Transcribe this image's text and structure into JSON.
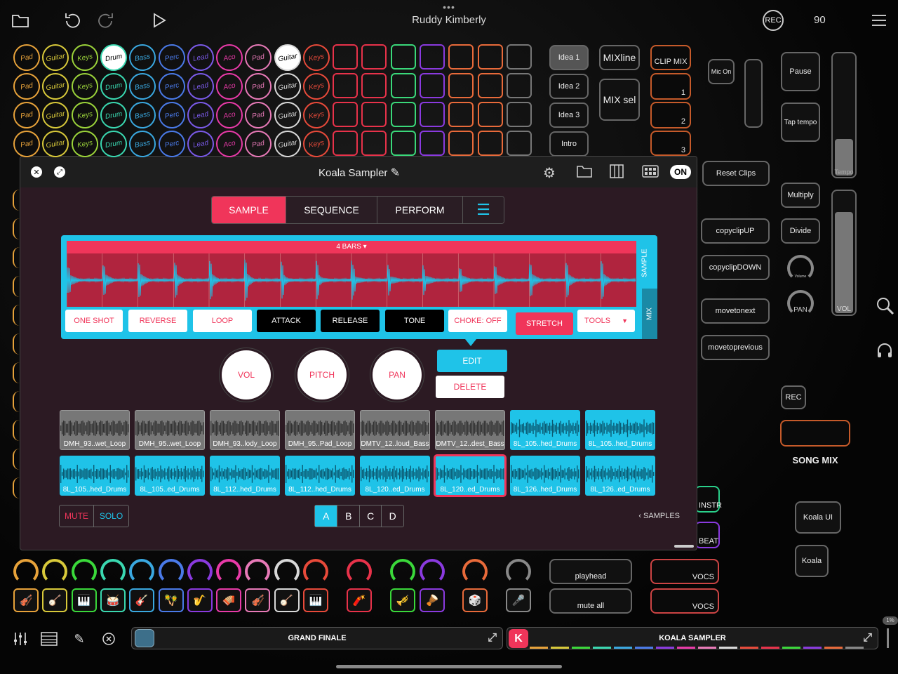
{
  "app": {
    "title": "Ruddy Kimberly",
    "tempo": "90",
    "rec_label": "REC"
  },
  "top_icons": [
    "folder-icon",
    "undo-icon",
    "redo-icon",
    "play-icon",
    "menu-icon"
  ],
  "pad_row_labels": [
    "Pad",
    "Guitar",
    "Keys",
    "Drum",
    "Bass",
    "Perc",
    "Lead",
    "Aco",
    "Pad",
    "Guitar",
    "Keys"
  ],
  "right_buttons": {
    "idea1": "Idea 1",
    "idea2": "Idea 2",
    "idea3": "Idea 3",
    "intro": "Intro",
    "mixline": "MIXline",
    "mixsel": "MIX sel",
    "clipmix": "CLIP MIX",
    "clip1": "1",
    "clip2": "2",
    "clip3": "3",
    "micon": "Mic On",
    "pause": "Pause",
    "taptempo": "Tap tempo",
    "tempo_label": "Tempo",
    "resetclips": "Reset Clips",
    "multiply": "Multiply",
    "copyclipup": "copyclipUP",
    "divide": "Divide",
    "copyclipdown": "copyclipDOWN",
    "volume": "Volume",
    "pan": "PAN",
    "vol": "VOL",
    "movetonext": "movetonext",
    "movetoprevious": "movetoprevious",
    "rec": "REC",
    "songmix": "SONG MIX",
    "koalaui": "Koala UI",
    "koala": "Koala",
    "instr": "INSTR",
    "beat": "BEAT",
    "playhead": "playhead",
    "muteall": "mute all",
    "vocs1": "VOCS",
    "vocs2": "VOCS"
  },
  "sampler": {
    "title": "Koala Sampler",
    "on_label": "ON",
    "tabs": [
      "SAMPLE",
      "SEQUENCE",
      "PERFORM"
    ],
    "bars_label": "4 BARS ▾",
    "side_sample": "SAMPLE",
    "side_mix": "MIX",
    "wave_buttons": [
      "ONE SHOT",
      "REVERSE",
      "LOOP",
      "ATTACK",
      "RELEASE",
      "TONE",
      "CHOKE: OFF",
      "STRETCH",
      "TOOLS"
    ],
    "knobs": [
      "VOL",
      "PITCH",
      "PAN"
    ],
    "edit": "EDIT",
    "delete": "DELETE",
    "samples_row1": [
      "DMH_93..wet_Loop",
      "DMH_95..wet_Loop",
      "DMH_93..lody_Loop",
      "DMH_95..Pad_Loop",
      "DMTV_12..loud_Bass",
      "DMTV_12..dest_Bass",
      "8L_105..hed_Drums",
      "8L_105..hed_Drums"
    ],
    "samples_row2": [
      "8L_105..hed_Drums",
      "8L_105..ed_Drums",
      "8L_112..hed_Drums",
      "8L_112..hed_Drums",
      "8L_120..ed_Drums",
      "8L_120..ed_Drums",
      "8L_126..hed_Drums",
      "8L_126..ed_Drums"
    ],
    "mute": "MUTE",
    "solo": "SOLO",
    "banks": [
      "A",
      "B",
      "C",
      "D"
    ],
    "samples_link": "‹  SAMPLES"
  },
  "bottom": {
    "grand_finale": "GRAND FINALE",
    "koala_sampler": "KOALA SAMPLER",
    "k_badge": "K",
    "percent": "1%"
  },
  "colors": {
    "accent": "#f0355a",
    "cyan": "#1fc3e8",
    "panel": "#2c1a23"
  }
}
